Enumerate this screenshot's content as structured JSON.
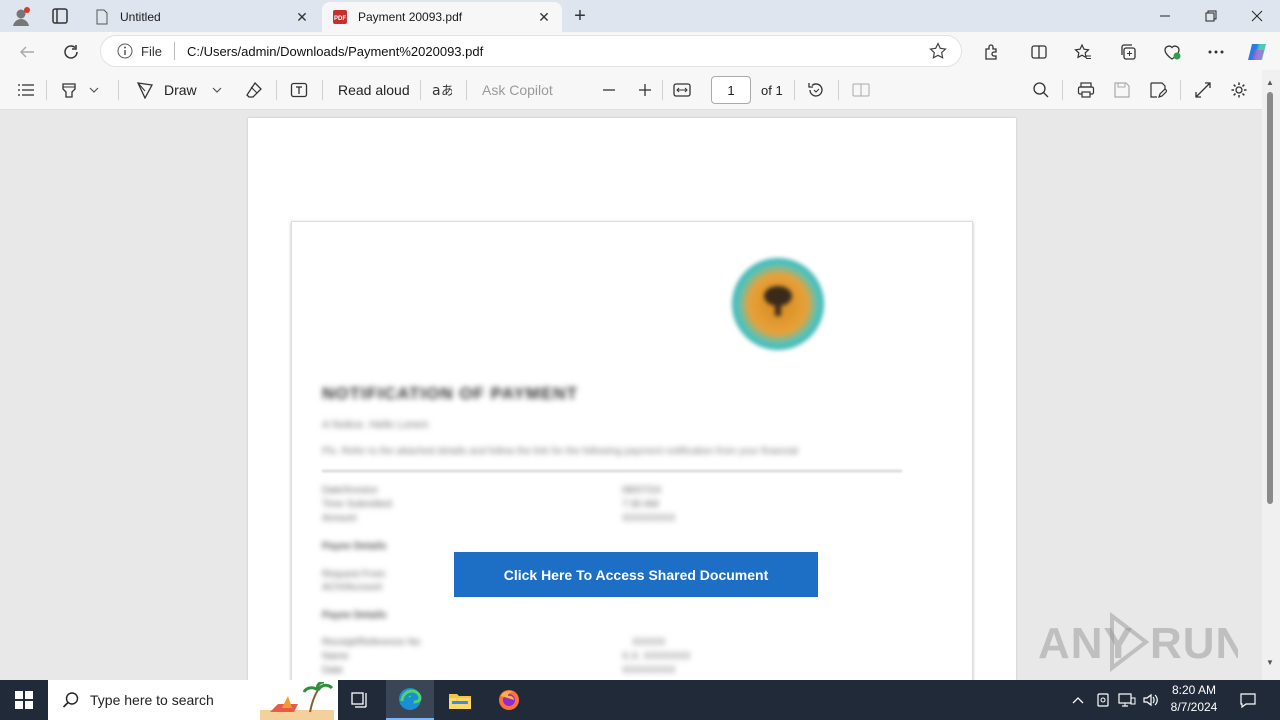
{
  "browser": {
    "tabs": [
      {
        "title": "Untitled",
        "active": false
      },
      {
        "title": "Payment 20093.pdf",
        "active": true
      }
    ],
    "address": {
      "scheme": "File",
      "url": "C:/Users/admin/Downloads/Payment%2020093.pdf"
    }
  },
  "pdf_toolbar": {
    "draw_label": "Draw",
    "read_aloud_label": "Read aloud",
    "ask_copilot_label": "Ask Copilot",
    "page_number": "1",
    "page_total": "of 1"
  },
  "document": {
    "title": "NOTIFICATION OF PAYMENT",
    "greeting": "A Notice. Hello Lorem",
    "intro": "Pls. Refer to the attached details and follow the link for the following payment notification from your financial",
    "fields": [
      {
        "label": "Date/Invoice",
        "value": "08/07/24"
      },
      {
        "label": "Time Submitted",
        "value": "7:30 AM"
      },
      {
        "label": "Amount",
        "value": "XXXXXXXX"
      }
    ],
    "section1": "Payee Details",
    "payee": [
      "Request From",
      "ACH/Account"
    ],
    "section2": "Payee Details",
    "rows": [
      {
        "label": "Receipt/Reference No",
        "value": "XXXXX"
      },
      {
        "label": "Name",
        "value": "X.X. XXXXXXX"
      },
      {
        "label": "Date",
        "value": "XXXXXXXX"
      }
    ],
    "cta_label": "Click Here To Access Shared Document"
  },
  "watermark": "ANY RUN",
  "taskbar": {
    "search_placeholder": "Type here to search",
    "time": "8:20 AM",
    "date": "8/7/2024"
  },
  "colors": {
    "cta": "#1c6fc4",
    "taskbar": "#202a38",
    "copilot_accent": "#2f7be6"
  }
}
